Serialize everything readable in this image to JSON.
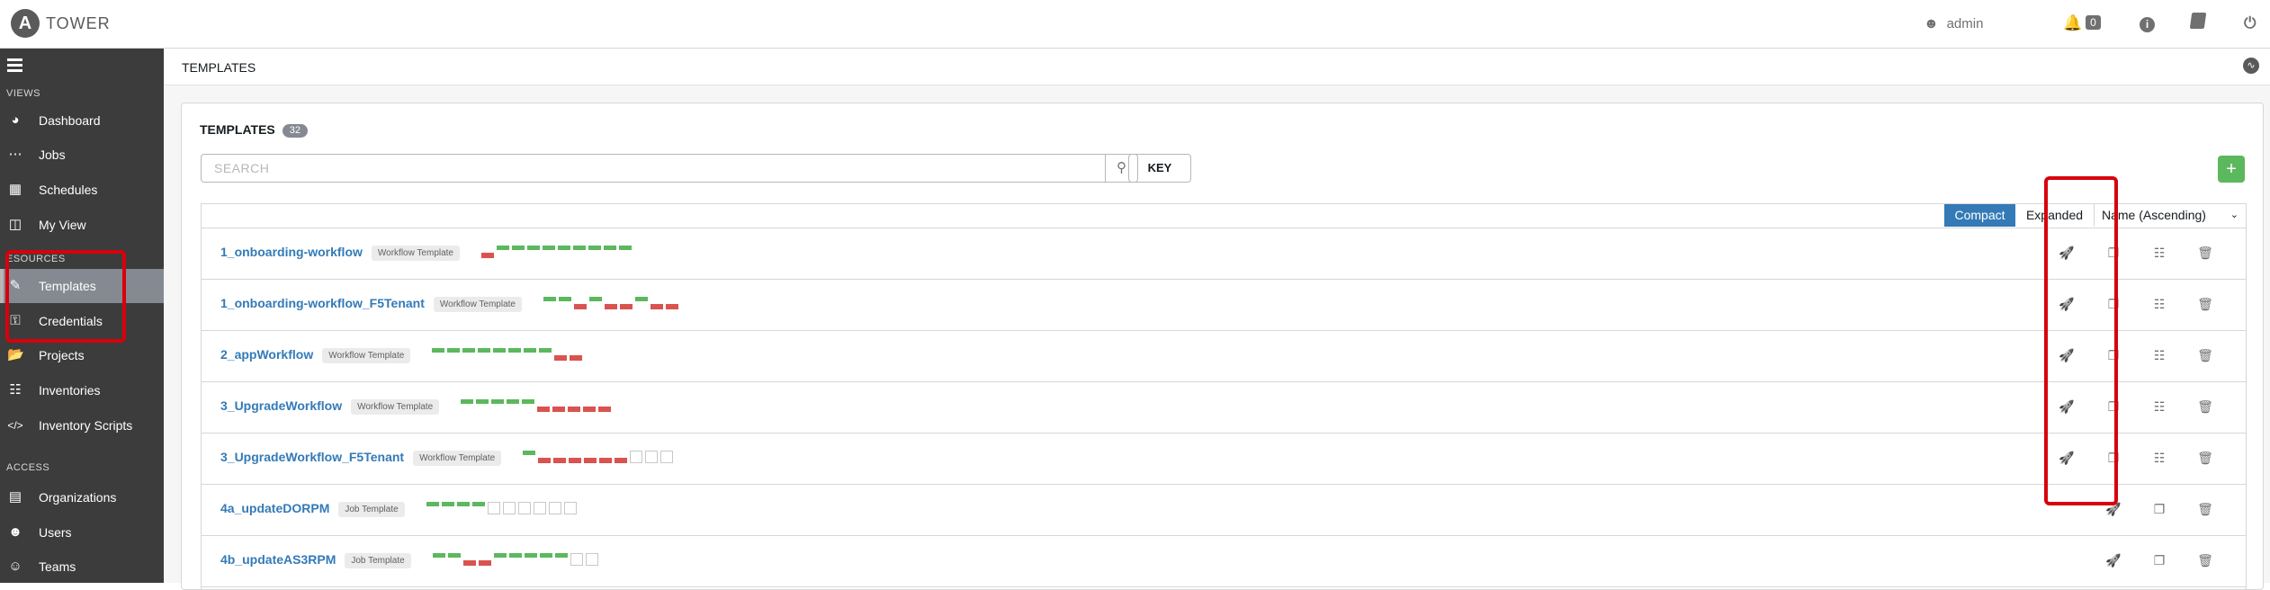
{
  "header": {
    "brand": "TOWER",
    "logo_letter": "A",
    "user": "admin",
    "notifications_count": "0",
    "icons": [
      "user-icon",
      "bell-icon",
      "info-icon",
      "book-icon",
      "power-icon"
    ]
  },
  "sidebar": {
    "sections": {
      "views": "VIEWS",
      "resources": "ESOURCES",
      "access": "ACCESS"
    },
    "items": [
      {
        "label": "Dashboard",
        "icon": "dashboard-icon"
      },
      {
        "label": "Jobs",
        "icon": "jobs-icon"
      },
      {
        "label": "Schedules",
        "icon": "calendar-icon"
      },
      {
        "label": "My View",
        "icon": "columns-icon"
      },
      {
        "label": "Templates",
        "icon": "pencil-icon",
        "active": true
      },
      {
        "label": "Credentials",
        "icon": "key-icon"
      },
      {
        "label": "Projects",
        "icon": "folder-icon"
      },
      {
        "label": "Inventories",
        "icon": "sitemap-icon"
      },
      {
        "label": "Inventory Scripts",
        "icon": "code-icon"
      },
      {
        "label": "Organizations",
        "icon": "building-icon"
      },
      {
        "label": "Users",
        "icon": "user-icon"
      },
      {
        "label": "Teams",
        "icon": "users-icon"
      }
    ]
  },
  "breadcrumb": "TEMPLATES",
  "panel": {
    "title": "TEMPLATES",
    "count": "32",
    "search_placeholder": "SEARCH",
    "key_label": "KEY",
    "add_label": "+",
    "views": {
      "compact": "Compact",
      "expanded": "Expanded"
    },
    "sort": "Name (Ascending)"
  },
  "rows": [
    {
      "name": "1_onboarding-workflow",
      "type": "Workflow Template",
      "jobs": "fsssssssss",
      "launch": true,
      "copy": true,
      "visualize": true
    },
    {
      "name": "1_onboarding-workflow_F5Tenant",
      "type": "Workflow Template",
      "jobs": "ssfsffsff",
      "launch": true,
      "copy": true,
      "visualize": true
    },
    {
      "name": "2_appWorkflow",
      "type": "Workflow Template",
      "jobs": "ssssssssff",
      "launch": true,
      "copy": true,
      "visualize": true
    },
    {
      "name": "3_UpgradeWorkflow",
      "type": "Workflow Template",
      "jobs": "sssssfffff",
      "launch": true,
      "copy": true,
      "visualize": true
    },
    {
      "name": "3_UpgradeWorkflow_F5Tenant",
      "type": "Workflow Template",
      "jobs": "sffffffeee",
      "launch": true,
      "copy": true,
      "visualize": true
    },
    {
      "name": "4a_updateDORPM",
      "type": "Job Template",
      "jobs": "sssseeeeee",
      "launch": true,
      "copy": true,
      "visualize": false
    },
    {
      "name": "4b_updateAS3RPM",
      "type": "Job Template",
      "jobs": "ssffsssssee",
      "launch": true,
      "copy": true,
      "visualize": false
    }
  ],
  "colors": {
    "sidebar": "#3c3c3c",
    "active_nav": "#848992",
    "link": "#337ab7",
    "success": "#5cb85c",
    "failed": "#d9534f",
    "highlight": "#d8000c"
  }
}
